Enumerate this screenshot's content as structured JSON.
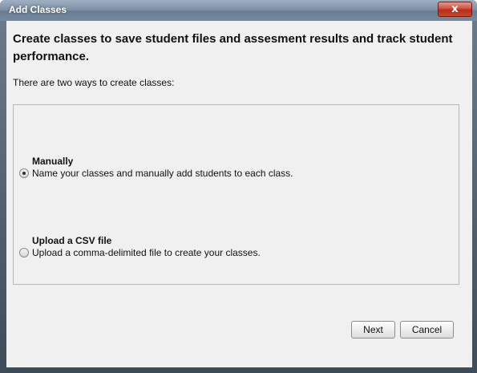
{
  "window": {
    "title": "Add Classes",
    "close_label": "x"
  },
  "content": {
    "heading": "Create classes to save student files and assesment results and track student performance.",
    "subtitle": "There are two ways to create classes:"
  },
  "options": [
    {
      "title": "Manually",
      "description": "Name your classes and manually add students to each class.",
      "selected": true
    },
    {
      "title": "Upload a CSV file",
      "description": "Upload a comma-delimited file to create your classes.",
      "selected": false
    }
  ],
  "buttons": {
    "next_label": "Next",
    "cancel_label": "Cancel"
  },
  "colors": {
    "titlebar": "#7f93a8",
    "close_button": "#c8462f",
    "background": "#f0f0f0"
  }
}
